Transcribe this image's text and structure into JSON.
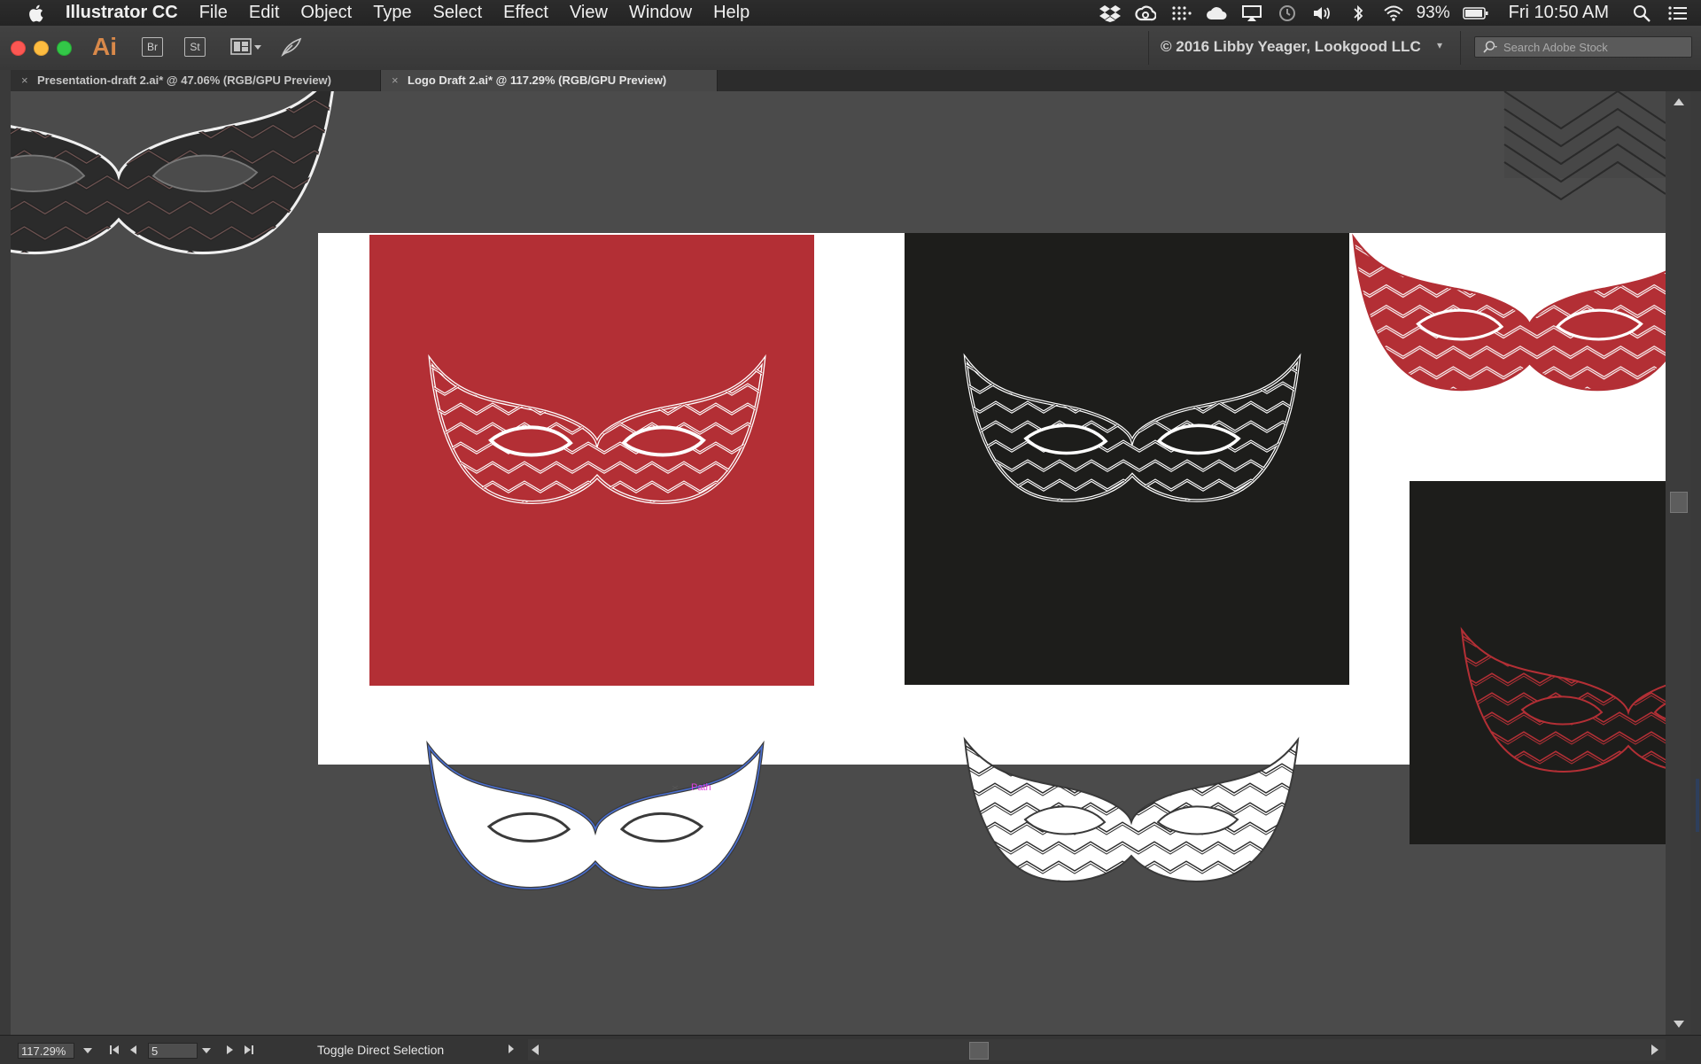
{
  "menubar": {
    "app_name": "Illustrator CC",
    "menus": [
      "File",
      "Edit",
      "Object",
      "Type",
      "Select",
      "Effect",
      "View",
      "Window",
      "Help"
    ],
    "battery": "93%",
    "clock": "Fri 10:50 AM",
    "status_icons": [
      "dropbox-icon",
      "creative-cloud-icon",
      "grid-icon",
      "cloud-icon",
      "airplay-icon",
      "time-machine-icon",
      "volume-icon",
      "bluetooth-icon",
      "wifi-icon",
      "battery-icon",
      "spotlight-icon",
      "notification-center-icon"
    ]
  },
  "appbar": {
    "logo": "Ai",
    "bridge_label": "Br",
    "stock_label": "St",
    "workspace": "© 2016 Libby Yeager, Lookgood LLC",
    "search_placeholder": "Search Adobe Stock"
  },
  "tabs": [
    {
      "close": "×",
      "label": "Presentation-draft 2.ai* @ 47.06% (RGB/GPU Preview)",
      "active": false
    },
    {
      "close": "×",
      "label": "Logo Draft 2.ai* @ 117.29% (RGB/GPU Preview)",
      "active": true
    }
  ],
  "canvas": {
    "path_hint": "Path",
    "colors": {
      "pasteboard": "#4b4b4b",
      "artboard": "#ffffff",
      "red": "#b32f35",
      "black": "#1d1d1b",
      "selection": "#4a6fd1"
    }
  },
  "statusbar": {
    "zoom": "117.29%",
    "artboard_number": "5",
    "status_text": "Toggle Direct Selection"
  }
}
